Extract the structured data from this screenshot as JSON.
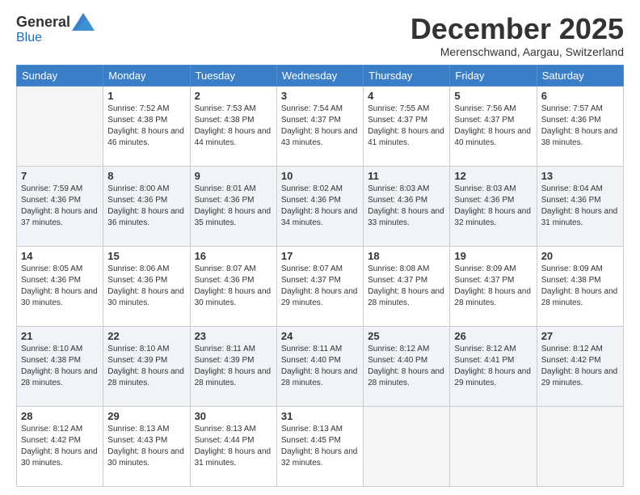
{
  "logo": {
    "general": "General",
    "blue": "Blue"
  },
  "title": "December 2025",
  "location": "Merenschwand, Aargau, Switzerland",
  "days_of_week": [
    "Sunday",
    "Monday",
    "Tuesday",
    "Wednesday",
    "Thursday",
    "Friday",
    "Saturday"
  ],
  "weeks": [
    [
      {
        "day": "",
        "sunrise": "",
        "sunset": "",
        "daylight": ""
      },
      {
        "day": "1",
        "sunrise": "Sunrise: 7:52 AM",
        "sunset": "Sunset: 4:38 PM",
        "daylight": "Daylight: 8 hours and 46 minutes."
      },
      {
        "day": "2",
        "sunrise": "Sunrise: 7:53 AM",
        "sunset": "Sunset: 4:38 PM",
        "daylight": "Daylight: 8 hours and 44 minutes."
      },
      {
        "day": "3",
        "sunrise": "Sunrise: 7:54 AM",
        "sunset": "Sunset: 4:37 PM",
        "daylight": "Daylight: 8 hours and 43 minutes."
      },
      {
        "day": "4",
        "sunrise": "Sunrise: 7:55 AM",
        "sunset": "Sunset: 4:37 PM",
        "daylight": "Daylight: 8 hours and 41 minutes."
      },
      {
        "day": "5",
        "sunrise": "Sunrise: 7:56 AM",
        "sunset": "Sunset: 4:37 PM",
        "daylight": "Daylight: 8 hours and 40 minutes."
      },
      {
        "day": "6",
        "sunrise": "Sunrise: 7:57 AM",
        "sunset": "Sunset: 4:36 PM",
        "daylight": "Daylight: 8 hours and 38 minutes."
      }
    ],
    [
      {
        "day": "7",
        "sunrise": "Sunrise: 7:59 AM",
        "sunset": "Sunset: 4:36 PM",
        "daylight": "Daylight: 8 hours and 37 minutes."
      },
      {
        "day": "8",
        "sunrise": "Sunrise: 8:00 AM",
        "sunset": "Sunset: 4:36 PM",
        "daylight": "Daylight: 8 hours and 36 minutes."
      },
      {
        "day": "9",
        "sunrise": "Sunrise: 8:01 AM",
        "sunset": "Sunset: 4:36 PM",
        "daylight": "Daylight: 8 hours and 35 minutes."
      },
      {
        "day": "10",
        "sunrise": "Sunrise: 8:02 AM",
        "sunset": "Sunset: 4:36 PM",
        "daylight": "Daylight: 8 hours and 34 minutes."
      },
      {
        "day": "11",
        "sunrise": "Sunrise: 8:03 AM",
        "sunset": "Sunset: 4:36 PM",
        "daylight": "Daylight: 8 hours and 33 minutes."
      },
      {
        "day": "12",
        "sunrise": "Sunrise: 8:03 AM",
        "sunset": "Sunset: 4:36 PM",
        "daylight": "Daylight: 8 hours and 32 minutes."
      },
      {
        "day": "13",
        "sunrise": "Sunrise: 8:04 AM",
        "sunset": "Sunset: 4:36 PM",
        "daylight": "Daylight: 8 hours and 31 minutes."
      }
    ],
    [
      {
        "day": "14",
        "sunrise": "Sunrise: 8:05 AM",
        "sunset": "Sunset: 4:36 PM",
        "daylight": "Daylight: 8 hours and 30 minutes."
      },
      {
        "day": "15",
        "sunrise": "Sunrise: 8:06 AM",
        "sunset": "Sunset: 4:36 PM",
        "daylight": "Daylight: 8 hours and 30 minutes."
      },
      {
        "day": "16",
        "sunrise": "Sunrise: 8:07 AM",
        "sunset": "Sunset: 4:36 PM",
        "daylight": "Daylight: 8 hours and 30 minutes."
      },
      {
        "day": "17",
        "sunrise": "Sunrise: 8:07 AM",
        "sunset": "Sunset: 4:37 PM",
        "daylight": "Daylight: 8 hours and 29 minutes."
      },
      {
        "day": "18",
        "sunrise": "Sunrise: 8:08 AM",
        "sunset": "Sunset: 4:37 PM",
        "daylight": "Daylight: 8 hours and 28 minutes."
      },
      {
        "day": "19",
        "sunrise": "Sunrise: 8:09 AM",
        "sunset": "Sunset: 4:37 PM",
        "daylight": "Daylight: 8 hours and 28 minutes."
      },
      {
        "day": "20",
        "sunrise": "Sunrise: 8:09 AM",
        "sunset": "Sunset: 4:38 PM",
        "daylight": "Daylight: 8 hours and 28 minutes."
      }
    ],
    [
      {
        "day": "21",
        "sunrise": "Sunrise: 8:10 AM",
        "sunset": "Sunset: 4:38 PM",
        "daylight": "Daylight: 8 hours and 28 minutes."
      },
      {
        "day": "22",
        "sunrise": "Sunrise: 8:10 AM",
        "sunset": "Sunset: 4:39 PM",
        "daylight": "Daylight: 8 hours and 28 minutes."
      },
      {
        "day": "23",
        "sunrise": "Sunrise: 8:11 AM",
        "sunset": "Sunset: 4:39 PM",
        "daylight": "Daylight: 8 hours and 28 minutes."
      },
      {
        "day": "24",
        "sunrise": "Sunrise: 8:11 AM",
        "sunset": "Sunset: 4:40 PM",
        "daylight": "Daylight: 8 hours and 28 minutes."
      },
      {
        "day": "25",
        "sunrise": "Sunrise: 8:12 AM",
        "sunset": "Sunset: 4:40 PM",
        "daylight": "Daylight: 8 hours and 28 minutes."
      },
      {
        "day": "26",
        "sunrise": "Sunrise: 8:12 AM",
        "sunset": "Sunset: 4:41 PM",
        "daylight": "Daylight: 8 hours and 29 minutes."
      },
      {
        "day": "27",
        "sunrise": "Sunrise: 8:12 AM",
        "sunset": "Sunset: 4:42 PM",
        "daylight": "Daylight: 8 hours and 29 minutes."
      }
    ],
    [
      {
        "day": "28",
        "sunrise": "Sunrise: 8:12 AM",
        "sunset": "Sunset: 4:42 PM",
        "daylight": "Daylight: 8 hours and 30 minutes."
      },
      {
        "day": "29",
        "sunrise": "Sunrise: 8:13 AM",
        "sunset": "Sunset: 4:43 PM",
        "daylight": "Daylight: 8 hours and 30 minutes."
      },
      {
        "day": "30",
        "sunrise": "Sunrise: 8:13 AM",
        "sunset": "Sunset: 4:44 PM",
        "daylight": "Daylight: 8 hours and 31 minutes."
      },
      {
        "day": "31",
        "sunrise": "Sunrise: 8:13 AM",
        "sunset": "Sunset: 4:45 PM",
        "daylight": "Daylight: 8 hours and 32 minutes."
      },
      {
        "day": "",
        "sunrise": "",
        "sunset": "",
        "daylight": ""
      },
      {
        "day": "",
        "sunrise": "",
        "sunset": "",
        "daylight": ""
      },
      {
        "day": "",
        "sunrise": "",
        "sunset": "",
        "daylight": ""
      }
    ]
  ]
}
